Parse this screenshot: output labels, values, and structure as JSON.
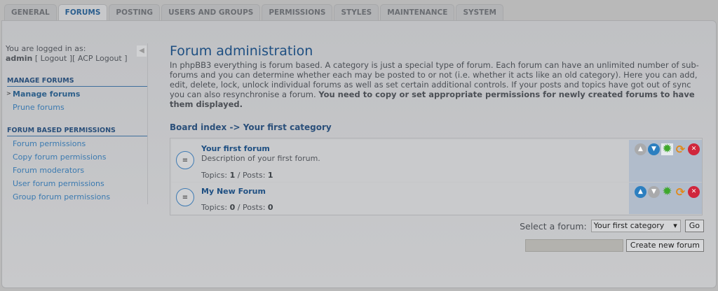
{
  "tabs": [
    "GENERAL",
    "FORUMS",
    "POSTING",
    "USERS AND GROUPS",
    "PERMISSIONS",
    "STYLES",
    "MAINTENANCE",
    "SYSTEM"
  ],
  "active_tab": "FORUMS",
  "sidebar": {
    "logged_in_label": "You are logged in as:",
    "username": "admin",
    "logout": "Logout",
    "acp_logout": "ACP Logout",
    "sections": [
      {
        "title": "MANAGE FORUMS",
        "items": [
          "Manage forums",
          "Prune forums"
        ]
      },
      {
        "title": "FORUM BASED PERMISSIONS",
        "items": [
          "Forum permissions",
          "Copy forum permissions",
          "Forum moderators",
          "User forum permissions",
          "Group forum permissions"
        ]
      }
    ],
    "active_item": "Manage forums"
  },
  "main": {
    "title": "Forum administration",
    "intro": "In phpBB3 everything is forum based. A category is just a special type of forum. Each forum can have an unlimited number of sub-forums and you can determine whether each may be posted to or not (i.e. whether it acts like an old category). Here you can add, edit, delete, lock, unlock individual forums as well as set certain additional controls. If your posts and topics have got out of sync you can also resynchronise a forum.",
    "intro_bold": "You need to copy or set appropriate permissions for newly created forums to have them displayed.",
    "breadcrumb": {
      "root": "Board index",
      "sep": "->",
      "current": "Your first category"
    },
    "forums": [
      {
        "name": "Your first forum",
        "description": "Description of your first forum.",
        "topics_label": "Topics:",
        "topics": "1",
        "posts_label": "Posts:",
        "posts": "1"
      },
      {
        "name": "My New Forum",
        "description": "",
        "topics_label": "Topics:",
        "topics": "0",
        "posts_label": "Posts:",
        "posts": "0"
      }
    ],
    "select_label": "Select a forum:",
    "select_value": "Your first category",
    "go": "Go",
    "create_input": "",
    "create_button": "Create new forum"
  }
}
